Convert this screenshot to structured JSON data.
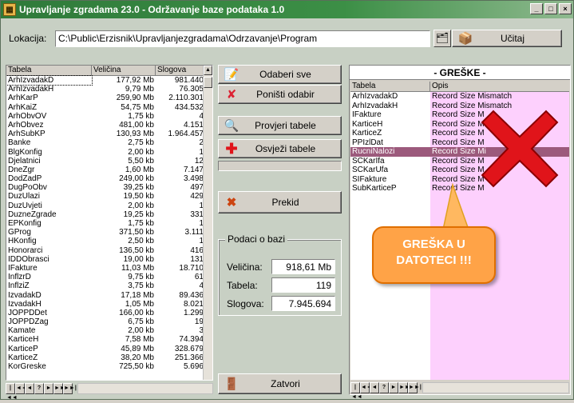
{
  "window": {
    "title": "Upravljanje zgradama 23.0 - Održavanje baze podataka 1.0",
    "controls": [
      "_",
      "□",
      "×"
    ]
  },
  "location": {
    "label": "Lokacija:",
    "path": "C:\\Public\\Erzisnik\\Upravljanjezgradama\\Odrzavanje\\Program",
    "load_label": "Učitaj"
  },
  "tables": {
    "headers": [
      "Tabela",
      "Veličina",
      "Slogova"
    ],
    "rows": [
      [
        "ArhIzvadakD",
        "177,92 Mb",
        "981.440"
      ],
      [
        "ArhIzvadakH",
        "9,79 Mb",
        "76.305"
      ],
      [
        "ArhKarP",
        "259,90 Mb",
        "2.110.301"
      ],
      [
        "ArhKaiZ",
        "54,75 Mb",
        "434.532"
      ],
      [
        "ArhObvOV",
        "1,75 kb",
        "4"
      ],
      [
        "ArhObvez",
        "481,00 kb",
        "4.151"
      ],
      [
        "ArhSubKP",
        "130,93 Mb",
        "1.964.457"
      ],
      [
        "Banke",
        "2,75 kb",
        "2"
      ],
      [
        "BlgKonfig",
        "2,00 kb",
        "1"
      ],
      [
        "Djelatnici",
        "5,50 kb",
        "12"
      ],
      [
        "DneZgr",
        "1,60 Mb",
        "7.147"
      ],
      [
        "DodZadP",
        "249,00 kb",
        "3.498"
      ],
      [
        "DugPoObv",
        "39,25 kb",
        "497"
      ],
      [
        "DuzUlazi",
        "19,50 kb",
        "429"
      ],
      [
        "DuzUvjeti",
        "2,00 kb",
        "1"
      ],
      [
        "DuzneZgrade",
        "19,25 kb",
        "331"
      ],
      [
        "EPKonfig",
        "1,75 kb",
        "1"
      ],
      [
        "GProg",
        "371,50 kb",
        "3.111"
      ],
      [
        "HKonfig",
        "2,50 kb",
        "1"
      ],
      [
        "Honorarci",
        "136,50 kb",
        "416"
      ],
      [
        "IDDObrasci",
        "19,00 kb",
        "131"
      ],
      [
        "IFakture",
        "11,03 Mb",
        "18.710"
      ],
      [
        "InflzrD",
        "9,75 kb",
        "61"
      ],
      [
        "InflziZ",
        "3,75 kb",
        "4"
      ],
      [
        "IzvadakD",
        "17,18 Mb",
        "89.436"
      ],
      [
        "IzvadakH",
        "1,05 Mb",
        "8.021"
      ],
      [
        "JOPPDDet",
        "166,00 kb",
        "1.299"
      ],
      [
        "JOPPDZag",
        "6,75 kb",
        "19"
      ],
      [
        "Kamate",
        "2,00 kb",
        "3"
      ],
      [
        "KarticeH",
        "7,58 Mb",
        "74.394"
      ],
      [
        "KarticeP",
        "45,89 Mb",
        "328.679"
      ],
      [
        "KarticeZ",
        "38,20 Mb",
        "251.366"
      ],
      [
        "KorGreske",
        "725,50 kb",
        "5.696"
      ]
    ]
  },
  "buttons": {
    "select_all": "Odaberi sve",
    "deselect": "Poništi odabir",
    "check_tables": "Provjeri tabele",
    "refresh_tables": "Osvježi tabele",
    "abort": "Prekid",
    "close": "Zatvori"
  },
  "db_info": {
    "title": "Podaci o bazi",
    "size_label": "Veličina:",
    "size_value": "918,61 Mb",
    "tables_label": "Tabela:",
    "tables_value": "119",
    "records_label": "Slogova:",
    "records_value": "7.945.694"
  },
  "errors": {
    "title": "- GREŠKE -",
    "headers": [
      "Tabela",
      "Opis"
    ],
    "rows": [
      [
        "ArhIzvadakD",
        "Record Size Mismatch"
      ],
      [
        "ArhIzvadakH",
        "Record Size Mismatch"
      ],
      [
        "IFakture",
        "Record Size M"
      ],
      [
        "KarticeH",
        "Record Size M"
      ],
      [
        "KarticeZ",
        "Record Size M"
      ],
      [
        "PPIzlDat",
        "Record Size M"
      ],
      [
        "RucniNalozi",
        "Record Size Mi"
      ],
      [
        "SCKarIfa",
        "Record Size M"
      ],
      [
        "SCKarUfa",
        "Record Size M"
      ],
      [
        "SIFakture",
        "Record Size M"
      ],
      [
        "SubKarticeP",
        "Record Size M"
      ]
    ],
    "highlighted_row": 6
  },
  "annotation": {
    "line1": "GREŠKA U",
    "line2": "DATOTECI !!!"
  },
  "nav_glyphs": [
    "|◄◄",
    "◄◄",
    "◄",
    "?",
    "►",
    "►►",
    "►►|"
  ],
  "colors": {
    "title_green": "#2f7a3a",
    "error_bg": "#fdd0fd",
    "highlight_row": "#9c5a7c",
    "callout": "#ffa347",
    "x_red": "#e0141a"
  }
}
